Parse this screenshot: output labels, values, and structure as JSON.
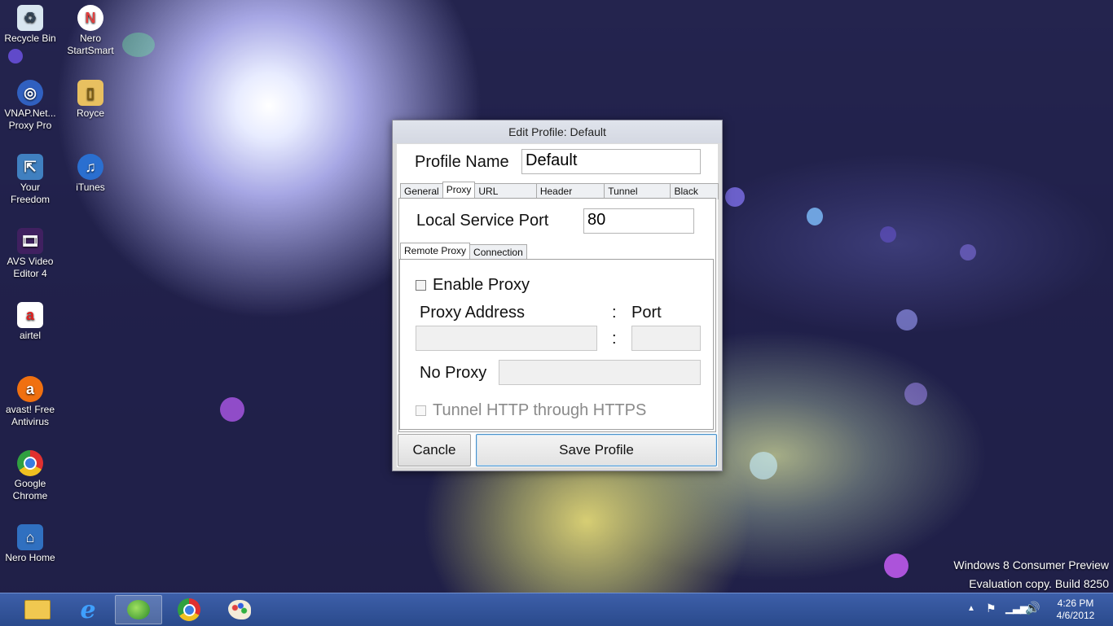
{
  "desktop": {
    "icons": [
      {
        "label": "Recycle Bin",
        "icon": "recycle-bin-icon",
        "color": "#d8e6f0"
      },
      {
        "label": "Nero StartSmart",
        "icon": "nero-icon",
        "color": "#e04040"
      },
      {
        "label": "VNAP.Net... Proxy Pro",
        "icon": "globe-icon",
        "color": "#3060c0"
      },
      {
        "label": "Royce",
        "icon": "folder-icon",
        "color": "#e8c060"
      },
      {
        "label": "Your Freedom",
        "icon": "freedom-icon",
        "color": "#4080c0"
      },
      {
        "label": "iTunes",
        "icon": "itunes-icon",
        "color": "#2a6fd0"
      },
      {
        "label": "AVS Video Editor 4",
        "icon": "film-icon",
        "color": "#402060"
      },
      {
        "label": "airtel",
        "icon": "airtel-icon",
        "color": "#e02020"
      },
      {
        "label": "avast! Free Antivirus",
        "icon": "avast-icon",
        "color": "#f07010"
      },
      {
        "label": "Google Chrome",
        "icon": "chrome-icon",
        "color": "#30a040"
      },
      {
        "label": "Nero Home",
        "icon": "nero-home-icon",
        "color": "#3070c0"
      }
    ]
  },
  "dialog": {
    "title": "Edit Profile: Default",
    "profile_name_label": "Profile Name",
    "profile_name_value": "Default",
    "tabs": [
      "General",
      "Proxy",
      "URL Handler",
      "Header Tweak",
      "Tunnel Option",
      "Black List"
    ],
    "active_tab": "Proxy",
    "local_port_label": "Local Service Port",
    "local_port_value": "80",
    "subtabs": [
      "Remote Proxy",
      "Connection"
    ],
    "active_subtab": "Remote Proxy",
    "enable_proxy_label": "Enable Proxy",
    "enable_proxy_checked": false,
    "proxy_address_label": "Proxy Address",
    "colon": ":",
    "port_label": "Port",
    "proxy_address_value": "",
    "port_value": "",
    "no_proxy_label": "No Proxy",
    "no_proxy_value": "",
    "tunnel_label": "Tunnel HTTP through HTTPS",
    "tunnel_checked": false,
    "cancel_label": "Cancle",
    "save_label": "Save Profile"
  },
  "watermark": {
    "line1": "Windows 8 Consumer Preview",
    "line2": "Evaluation copy. Build 8250"
  },
  "taskbar": {
    "apps": [
      {
        "name": "file-explorer-icon"
      },
      {
        "name": "internet-explorer-icon"
      },
      {
        "name": "internet-download-manager-icon"
      },
      {
        "name": "chrome-icon"
      },
      {
        "name": "paint-icon"
      }
    ],
    "time": "4:26 PM",
    "date": "4/6/2012"
  }
}
